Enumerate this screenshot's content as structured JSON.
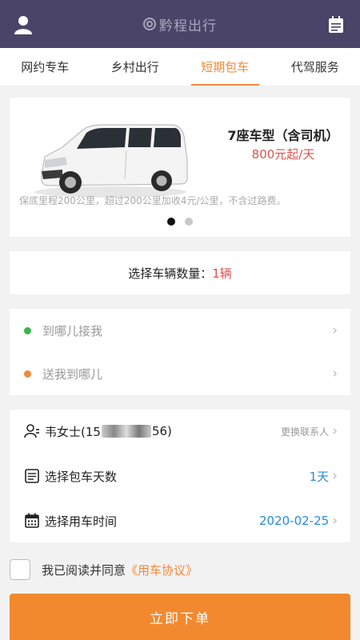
{
  "header": {
    "title": "黔程出行",
    "logo_icon": "swirl-logo-icon",
    "user_icon": "user-icon",
    "calendar_icon": "calendar-list-icon"
  },
  "tabs": [
    {
      "label": "网约专车",
      "active": false
    },
    {
      "label": "乡村出行",
      "active": false
    },
    {
      "label": "短期包车",
      "active": true
    },
    {
      "label": "代驾服务",
      "active": false
    }
  ],
  "car": {
    "name": "7座车型（含司机）",
    "price": "800元起/天",
    "description": "保底里程200公里，超过200公里加收4元/公里，不含过路费。",
    "carousel_pages": 2,
    "carousel_current": 1
  },
  "quantity": {
    "label": "选择车辆数量：",
    "value": "1辆"
  },
  "address": {
    "pickup": "到哪儿接我",
    "dropoff": "送我到哪儿",
    "pickup_color": "#3cb34a",
    "dropoff_color": "#f08a3c"
  },
  "contact": {
    "name_prefix": "韦女士(15",
    "name_suffix": "56)",
    "change_label": "更换联系人"
  },
  "days": {
    "label": "选择包车天数",
    "value": "1天"
  },
  "time": {
    "label": "选择用车时间",
    "value": "2020-02-25"
  },
  "agreement": {
    "text": "我已阅读并同意",
    "link": "《用车协议》",
    "checked": false
  },
  "submit": {
    "label": "立即下单"
  },
  "colors": {
    "header_bg": "#4a4468",
    "accent": "#f08a3c",
    "price_red": "#d9534f",
    "value_blue": "#2a8ad6"
  }
}
